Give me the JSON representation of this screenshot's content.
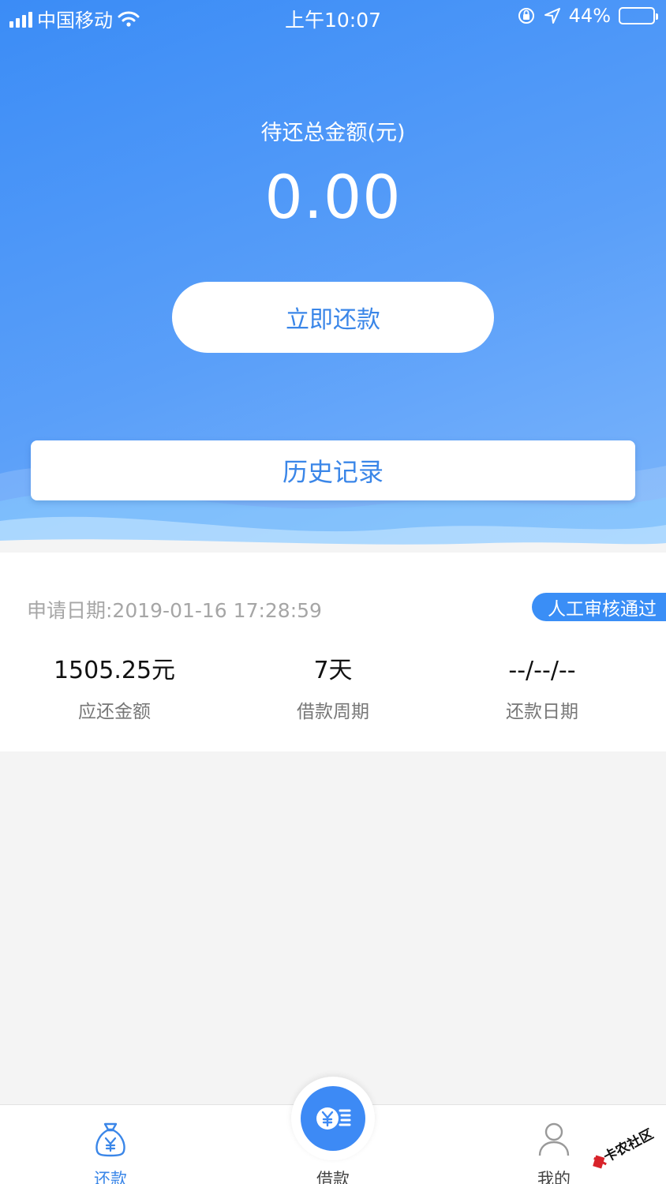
{
  "status_bar": {
    "carrier": "中国移动",
    "time": "上午10:07",
    "battery": "44%",
    "battery_level": 0.44
  },
  "summary": {
    "label": "待还总金额(元)",
    "amount": "0.00",
    "repay_button": "立即还款",
    "history_button": "历史记录"
  },
  "loan_card": {
    "apply_date": "申请日期:2019-01-16 17:28:59",
    "status": "人工审核通过",
    "stats": [
      {
        "value": "1505.25元",
        "label": "应还金额"
      },
      {
        "value": "7天",
        "label": "借款周期"
      },
      {
        "value": "--/--/--",
        "label": "还款日期"
      }
    ]
  },
  "tabbar": {
    "tabs": [
      {
        "label": "还款",
        "icon": "money-bag-icon",
        "active": true
      },
      {
        "label": "借款",
        "icon": "yuan-coin-icon",
        "active": false
      },
      {
        "label": "我的",
        "icon": "user-icon",
        "active": false
      }
    ]
  },
  "watermark": {
    "text": "卡农社区"
  },
  "colors": {
    "primary": "#3a86e8",
    "hero_start": "#3b8cf6",
    "hero_end": "#7db6fb"
  }
}
